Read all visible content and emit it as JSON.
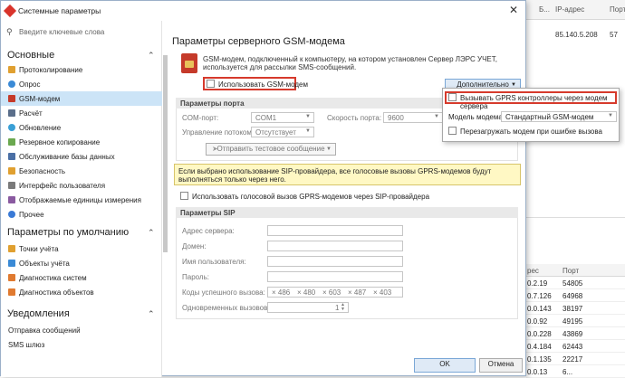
{
  "background": {
    "header": {
      "col1": "Б...",
      "col2": "IP-адрес",
      "col3": "Порт"
    },
    "row1": {
      "ip": "85.140.5.208",
      "port": "57"
    },
    "grid": {
      "header": {
        "col1": "рес",
        "col2": "Порт"
      },
      "rows": [
        {
          "addr": "0.2.19",
          "port": "54805"
        },
        {
          "addr": "0.7.126",
          "port": "64968"
        },
        {
          "addr": "0.0.143",
          "port": "38197"
        },
        {
          "addr": "0.0.92",
          "port": "49195"
        },
        {
          "addr": "0.0.228",
          "port": "43869"
        },
        {
          "addr": "0.4.184",
          "port": "62443"
        },
        {
          "addr": "0.1.135",
          "port": "22217"
        },
        {
          "addr": "0.0.13",
          "port": "6..."
        }
      ]
    }
  },
  "window": {
    "title": "Системные параметры",
    "close": "✕"
  },
  "sidebar": {
    "search_placeholder": "Введите ключевые слова",
    "groups": [
      {
        "label": "Основные",
        "items": [
          "Протоколирование",
          "Опрос",
          "GSM-модем",
          "Расчёт",
          "Обновление",
          "Резервное копирование",
          "Обслуживание базы данных",
          "Безопасность",
          "Интерфейс пользователя",
          "Отображаемые единицы измерения",
          "Прочее"
        ]
      },
      {
        "label": "Параметры по умолчанию",
        "items": [
          "Точки учёта",
          "Объекты учёта",
          "Диагностика систем",
          "Диагностика объектов"
        ]
      },
      {
        "label": "Уведомления",
        "items": [
          "Отправка сообщений",
          "SMS шлюз"
        ]
      }
    ],
    "chevron": "⌃",
    "colors": {
      "selected": "#cce4f7"
    }
  },
  "content": {
    "title": "Параметры серверного GSM-модема",
    "description": "GSM-модем, подключенный к компьютеру, на котором установлен Сервер ЛЭРС УЧЕТ, используется для рассылки SMS-сообщений.",
    "use_gsm_label": "Использовать GSM-модем",
    "advanced_button": "Дополнительно",
    "port_section": {
      "header": "Параметры порта",
      "com_label": "COM-порт:",
      "com_value": "COM1",
      "speed_label": "Скорость порта:",
      "speed_value": "9600",
      "flow_label": "Управление потоком:",
      "flow_value": "Отсутствует",
      "test_button": "Отправить тестовое сообщение"
    },
    "warning": "Если выбрано использование SIP-провайдера, все голосовые вызовы GPRS-модемов будут выполняться только через него.",
    "voice_call_label": "Использовать голосовой вызов GPRS-модемов через SIP-провайдера",
    "sip_section": {
      "header": "Параметры SIP",
      "server_label": "Адрес сервера:",
      "domain_label": "Домен:",
      "user_label": "Имя пользователя:",
      "password_label": "Пароль:",
      "codes_label": "Коды успешного вызова:",
      "codes": [
        "486",
        "480",
        "603",
        "487",
        "403"
      ],
      "concurrent_label": "Одновременных вызовов:",
      "concurrent_value": "1"
    }
  },
  "popup": {
    "call_gprs_label": "Вызывать GPRS контроллеры через модем сервера",
    "model_label": "Модель модема:",
    "model_value": "Стандартный GSM-модем",
    "restart_label": "Перезагружать модем при ошибке вызова"
  },
  "footer": {
    "ok": "OK",
    "cancel": "Отмена"
  },
  "colors": {
    "highlight_border": "#d63a2c",
    "warning_bg": "#fff8c4"
  }
}
